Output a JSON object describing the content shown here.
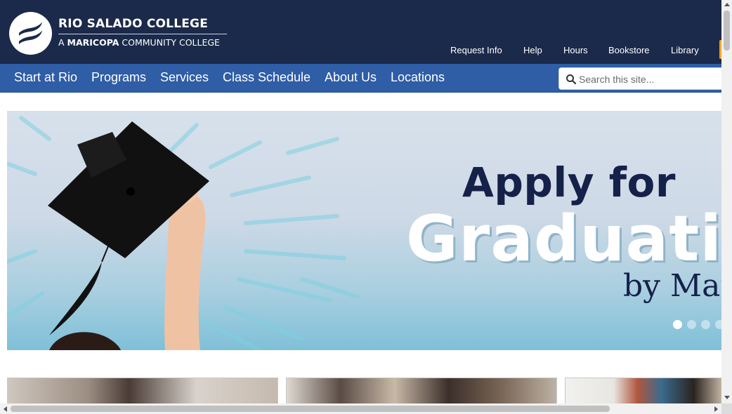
{
  "logo": {
    "line1": "RIO SALADO COLLEGE",
    "line2_prefix": "A ",
    "line2_bold": "MARICOPA",
    "line2_suffix": " COMMUNITY COLLEGE"
  },
  "utility_nav": [
    "Request Info",
    "Help",
    "Hours",
    "Bookstore",
    "Library"
  ],
  "main_nav": [
    "Start at Rio",
    "Programs",
    "Services",
    "Class Schedule",
    "About Us",
    "Locations"
  ],
  "search": {
    "placeholder": "Search this site..."
  },
  "hero": {
    "line1": "Apply for",
    "line2": "Graduatio",
    "line3": "by Marc",
    "slides_total": 4,
    "slide_active": 1
  },
  "colors": {
    "header_bg": "#1b2a4a",
    "nav_bg": "#2f5da6",
    "hero_heading": "#16214a",
    "accent_orange": "#f5a623"
  },
  "icons": {
    "search": "search-icon",
    "logo": "rio-salado-logo-icon"
  }
}
